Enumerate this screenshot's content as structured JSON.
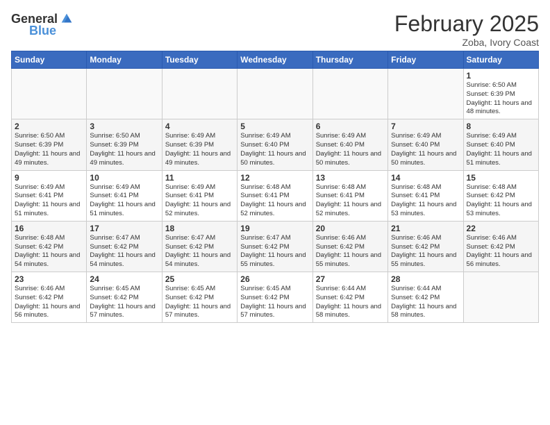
{
  "logo": {
    "general": "General",
    "blue": "Blue"
  },
  "title": "February 2025",
  "subtitle": "Zoba, Ivory Coast",
  "days_of_week": [
    "Sunday",
    "Monday",
    "Tuesday",
    "Wednesday",
    "Thursday",
    "Friday",
    "Saturday"
  ],
  "weeks": [
    [
      {
        "day": "",
        "info": ""
      },
      {
        "day": "",
        "info": ""
      },
      {
        "day": "",
        "info": ""
      },
      {
        "day": "",
        "info": ""
      },
      {
        "day": "",
        "info": ""
      },
      {
        "day": "",
        "info": ""
      },
      {
        "day": "1",
        "info": "Sunrise: 6:50 AM\nSunset: 6:39 PM\nDaylight: 11 hours and 48 minutes."
      }
    ],
    [
      {
        "day": "2",
        "info": "Sunrise: 6:50 AM\nSunset: 6:39 PM\nDaylight: 11 hours and 49 minutes."
      },
      {
        "day": "3",
        "info": "Sunrise: 6:50 AM\nSunset: 6:39 PM\nDaylight: 11 hours and 49 minutes."
      },
      {
        "day": "4",
        "info": "Sunrise: 6:49 AM\nSunset: 6:39 PM\nDaylight: 11 hours and 49 minutes."
      },
      {
        "day": "5",
        "info": "Sunrise: 6:49 AM\nSunset: 6:40 PM\nDaylight: 11 hours and 50 minutes."
      },
      {
        "day": "6",
        "info": "Sunrise: 6:49 AM\nSunset: 6:40 PM\nDaylight: 11 hours and 50 minutes."
      },
      {
        "day": "7",
        "info": "Sunrise: 6:49 AM\nSunset: 6:40 PM\nDaylight: 11 hours and 50 minutes."
      },
      {
        "day": "8",
        "info": "Sunrise: 6:49 AM\nSunset: 6:40 PM\nDaylight: 11 hours and 51 minutes."
      }
    ],
    [
      {
        "day": "9",
        "info": "Sunrise: 6:49 AM\nSunset: 6:41 PM\nDaylight: 11 hours and 51 minutes."
      },
      {
        "day": "10",
        "info": "Sunrise: 6:49 AM\nSunset: 6:41 PM\nDaylight: 11 hours and 51 minutes."
      },
      {
        "day": "11",
        "info": "Sunrise: 6:49 AM\nSunset: 6:41 PM\nDaylight: 11 hours and 52 minutes."
      },
      {
        "day": "12",
        "info": "Sunrise: 6:48 AM\nSunset: 6:41 PM\nDaylight: 11 hours and 52 minutes."
      },
      {
        "day": "13",
        "info": "Sunrise: 6:48 AM\nSunset: 6:41 PM\nDaylight: 11 hours and 52 minutes."
      },
      {
        "day": "14",
        "info": "Sunrise: 6:48 AM\nSunset: 6:41 PM\nDaylight: 11 hours and 53 minutes."
      },
      {
        "day": "15",
        "info": "Sunrise: 6:48 AM\nSunset: 6:42 PM\nDaylight: 11 hours and 53 minutes."
      }
    ],
    [
      {
        "day": "16",
        "info": "Sunrise: 6:48 AM\nSunset: 6:42 PM\nDaylight: 11 hours and 54 minutes."
      },
      {
        "day": "17",
        "info": "Sunrise: 6:47 AM\nSunset: 6:42 PM\nDaylight: 11 hours and 54 minutes."
      },
      {
        "day": "18",
        "info": "Sunrise: 6:47 AM\nSunset: 6:42 PM\nDaylight: 11 hours and 54 minutes."
      },
      {
        "day": "19",
        "info": "Sunrise: 6:47 AM\nSunset: 6:42 PM\nDaylight: 11 hours and 55 minutes."
      },
      {
        "day": "20",
        "info": "Sunrise: 6:46 AM\nSunset: 6:42 PM\nDaylight: 11 hours and 55 minutes."
      },
      {
        "day": "21",
        "info": "Sunrise: 6:46 AM\nSunset: 6:42 PM\nDaylight: 11 hours and 55 minutes."
      },
      {
        "day": "22",
        "info": "Sunrise: 6:46 AM\nSunset: 6:42 PM\nDaylight: 11 hours and 56 minutes."
      }
    ],
    [
      {
        "day": "23",
        "info": "Sunrise: 6:46 AM\nSunset: 6:42 PM\nDaylight: 11 hours and 56 minutes."
      },
      {
        "day": "24",
        "info": "Sunrise: 6:45 AM\nSunset: 6:42 PM\nDaylight: 11 hours and 57 minutes."
      },
      {
        "day": "25",
        "info": "Sunrise: 6:45 AM\nSunset: 6:42 PM\nDaylight: 11 hours and 57 minutes."
      },
      {
        "day": "26",
        "info": "Sunrise: 6:45 AM\nSunset: 6:42 PM\nDaylight: 11 hours and 57 minutes."
      },
      {
        "day": "27",
        "info": "Sunrise: 6:44 AM\nSunset: 6:42 PM\nDaylight: 11 hours and 58 minutes."
      },
      {
        "day": "28",
        "info": "Sunrise: 6:44 AM\nSunset: 6:42 PM\nDaylight: 11 hours and 58 minutes."
      },
      {
        "day": "",
        "info": ""
      }
    ]
  ]
}
